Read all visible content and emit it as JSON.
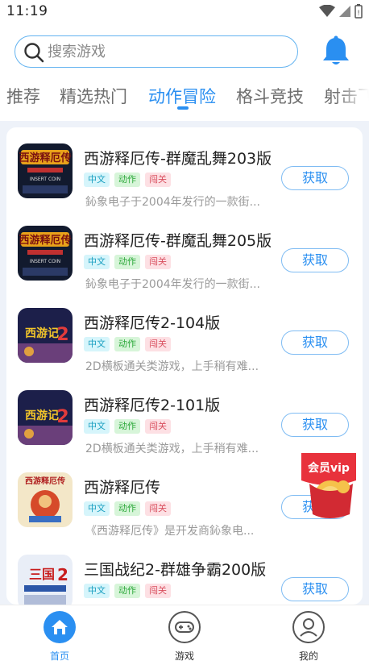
{
  "status_bar": {
    "time": "11:19"
  },
  "search": {
    "placeholder": "搜索游戏"
  },
  "tabs": [
    {
      "label": "推荐"
    },
    {
      "label": "精选热门"
    },
    {
      "label": "动作冒险",
      "active": true
    },
    {
      "label": "格斗竞技"
    },
    {
      "label": "射击飞行"
    }
  ],
  "games": [
    {
      "title": "西游释厄传-群魔乱舞203版",
      "tags": [
        "中文",
        "动作",
        "闯关"
      ],
      "desc": "鈊象电子于2004年发行的一款街...",
      "button": "获取",
      "thumb_icon": "xiyou-cover-icon"
    },
    {
      "title": "西游释厄传-群魔乱舞205版",
      "tags": [
        "中文",
        "动作",
        "闯关"
      ],
      "desc": "鈊象电子于2004年发行的一款街...",
      "button": "获取",
      "thumb_icon": "xiyou-cover-icon"
    },
    {
      "title": "西游释厄传2-104版",
      "tags": [
        "中文",
        "动作",
        "闯关"
      ],
      "desc": "2D横板通关类游戏，上手稍有难...",
      "button": "获取",
      "thumb_icon": "xiyou2-cover-icon"
    },
    {
      "title": "西游释厄传2-101版",
      "tags": [
        "中文",
        "动作",
        "闯关"
      ],
      "desc": "2D横板通关类游戏，上手稍有难...",
      "button": "获取",
      "thumb_icon": "xiyou2-cover-icon"
    },
    {
      "title": "西游释厄传",
      "tags": [
        "中文",
        "动作",
        "闯关"
      ],
      "desc": "《西游释厄传》是开发商鈊象电...",
      "button": "获取",
      "thumb_icon": "xiyou-classic-cover-icon"
    },
    {
      "title": "三国战纪2-群雄争霸200版",
      "tags": [
        "中文",
        "动作",
        "闯关"
      ],
      "desc": "",
      "button": "获取",
      "thumb_icon": "sanguo-cover-icon"
    }
  ],
  "vip": {
    "label": "会员vip"
  },
  "bottom_nav": [
    {
      "label": "首页",
      "icon": "home-icon",
      "active": true
    },
    {
      "label": "游戏",
      "icon": "gamepad-icon"
    },
    {
      "label": "我的",
      "icon": "profile-icon"
    }
  ],
  "colors": {
    "accent": "#2a8ff1",
    "list_background": "#eef2f9",
    "tag_chinese": "#1a9fc0",
    "tag_action": "#2ca83a",
    "tag_level": "#d9505f"
  }
}
